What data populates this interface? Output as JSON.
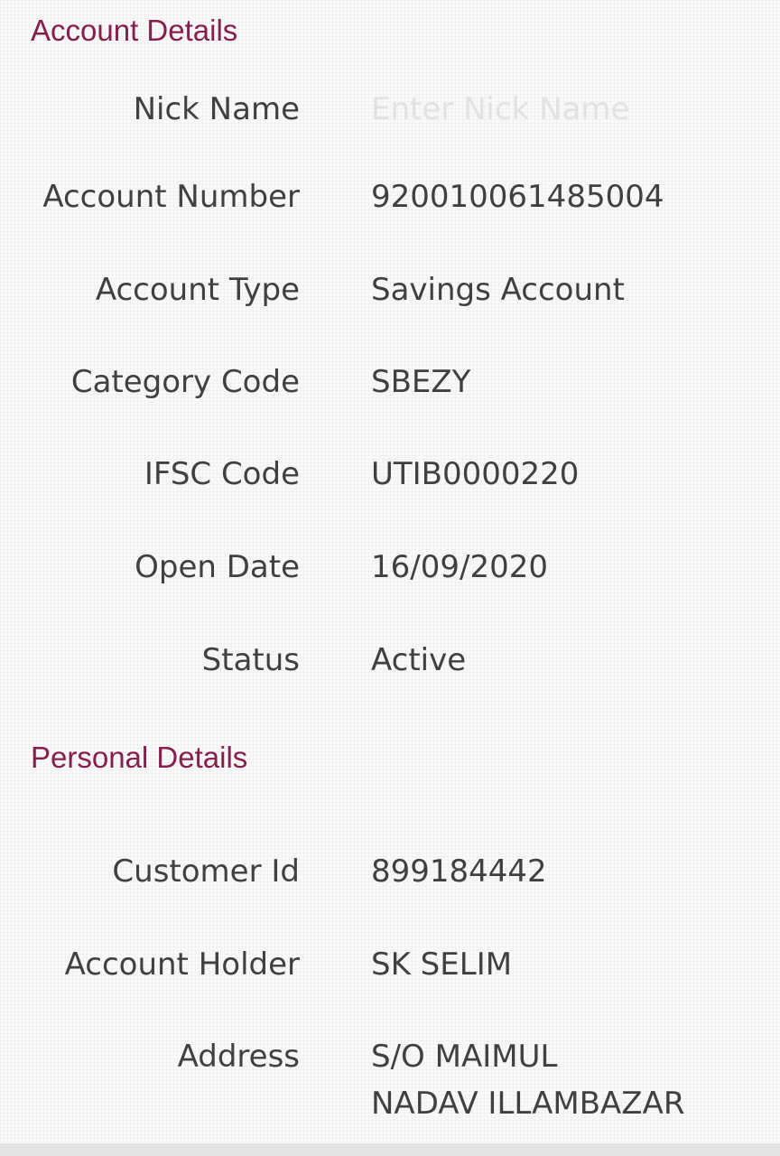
{
  "account_details": {
    "title": "Account Details",
    "nick_name": {
      "label": "Nick Name",
      "value": "",
      "placeholder": "Enter Nick Name"
    },
    "rows": [
      {
        "label": "Account Number",
        "value": "920010061485004"
      },
      {
        "label": "Account Type",
        "value": "Savings Account"
      },
      {
        "label": "Category Code",
        "value": "SBEZY"
      },
      {
        "label": "IFSC Code",
        "value": "UTIB0000220"
      },
      {
        "label": "Open Date",
        "value": "16/09/2020"
      },
      {
        "label": "Status",
        "value": "Active"
      }
    ]
  },
  "personal_details": {
    "title": "Personal Details",
    "rows": [
      {
        "label": "Customer Id",
        "value": "899184442"
      },
      {
        "label": "Account Holder",
        "value": "SK SELIM"
      }
    ],
    "address": {
      "label": "Address",
      "lines": [
        "S/O MAIMUL",
        "NADAV ILLAMBAZAR"
      ]
    }
  },
  "colors": {
    "section_title": "#871f4e",
    "text": "#404040",
    "placeholder": "#e2e2e2",
    "background": "#f9f9f9"
  }
}
